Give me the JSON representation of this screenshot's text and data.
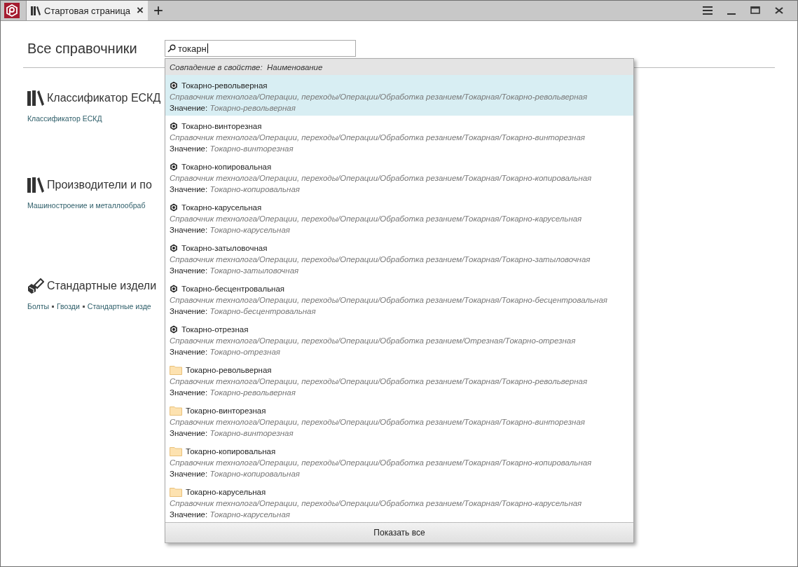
{
  "tabs": [
    {
      "label": "Стартовая страница",
      "close": "×",
      "selected": true
    }
  ],
  "new_tab": "+",
  "page_title": "Все справочники",
  "search": {
    "value": "токарн"
  },
  "sections": [
    {
      "kind": "books",
      "title": "Классификатор ЕСКД",
      "links": [
        "Классификатор ЕСКД"
      ]
    },
    {
      "kind": "books",
      "title": "Производители и по",
      "links": [
        "Машиностроение и металлообраб"
      ]
    },
    {
      "kind": "bolt",
      "title": "Стандартные издели",
      "links": [
        "Болты",
        "Гвозди",
        "Стандартные изде"
      ]
    }
  ],
  "dropdown": {
    "header_label": "Совпадение в свойстве:",
    "header_value": "Наименование",
    "items": [
      {
        "kind": "element",
        "selected": true,
        "name": "Токарно-револьверная",
        "path": "Справочник технолога/Операции, переходы/Операции/Обработка резанием/Токарная/Токарно-револьверная",
        "value_label": "Значение:",
        "value": "Токарно-револьверная"
      },
      {
        "kind": "element",
        "selected": false,
        "name": "Токарно-винторезная",
        "path": "Справочник технолога/Операции, переходы/Операции/Обработка резанием/Токарная/Токарно-винторезная",
        "value_label": "Значение:",
        "value": "Токарно-винторезная"
      },
      {
        "kind": "element",
        "selected": false,
        "name": "Токарно-копировальная",
        "path": "Справочник технолога/Операции, переходы/Операции/Обработка резанием/Токарная/Токарно-копировальная",
        "value_label": "Значение:",
        "value": "Токарно-копировальная"
      },
      {
        "kind": "element",
        "selected": false,
        "name": "Токарно-карусельная",
        "path": "Справочник технолога/Операции, переходы/Операции/Обработка резанием/Токарная/Токарно-карусельная",
        "value_label": "Значение:",
        "value": "Токарно-карусельная"
      },
      {
        "kind": "element",
        "selected": false,
        "name": "Токарно-затыловочная",
        "path": "Справочник технолога/Операции, переходы/Операции/Обработка резанием/Токарная/Токарно-затыловочная",
        "value_label": "Значение:",
        "value": "Токарно-затыловочная"
      },
      {
        "kind": "element",
        "selected": false,
        "name": "Токарно-бесцентровальная",
        "path": "Справочник технолога/Операции, переходы/Операции/Обработка резанием/Токарная/Токарно-бесцентровальная",
        "value_label": "Значение:",
        "value": "Токарно-бесцентровальная"
      },
      {
        "kind": "element",
        "selected": false,
        "name": "Токарно-отрезная",
        "path": "Справочник технолога/Операции, переходы/Операции/Обработка резанием/Отрезная/Токарно-отрезная",
        "value_label": "Значение:",
        "value": "Токарно-отрезная"
      },
      {
        "kind": "folder",
        "selected": false,
        "name": "Токарно-револьверная",
        "path": "Справочник технолога/Операции, переходы/Операции/Обработка резанием/Токарная/Токарно-револьверная",
        "value_label": "Значение:",
        "value": "Токарно-револьверная"
      },
      {
        "kind": "folder",
        "selected": false,
        "name": "Токарно-винторезная",
        "path": "Справочник технолога/Операции, переходы/Операции/Обработка резанием/Токарная/Токарно-винторезная",
        "value_label": "Значение:",
        "value": "Токарно-винторезная"
      },
      {
        "kind": "folder",
        "selected": false,
        "name": "Токарно-копировальная",
        "path": "Справочник технолога/Операции, переходы/Операции/Обработка резанием/Токарная/Токарно-копировальная",
        "value_label": "Значение:",
        "value": "Токарно-копировальная"
      },
      {
        "kind": "folder",
        "selected": false,
        "name": "Токарно-карусельная",
        "path": "Справочник технолога/Операции, переходы/Операции/Обработка резанием/Токарная/Токарно-карусельная",
        "value_label": "Значение:",
        "value": "Токарно-карусельная"
      }
    ],
    "show_all": "Показать все"
  }
}
